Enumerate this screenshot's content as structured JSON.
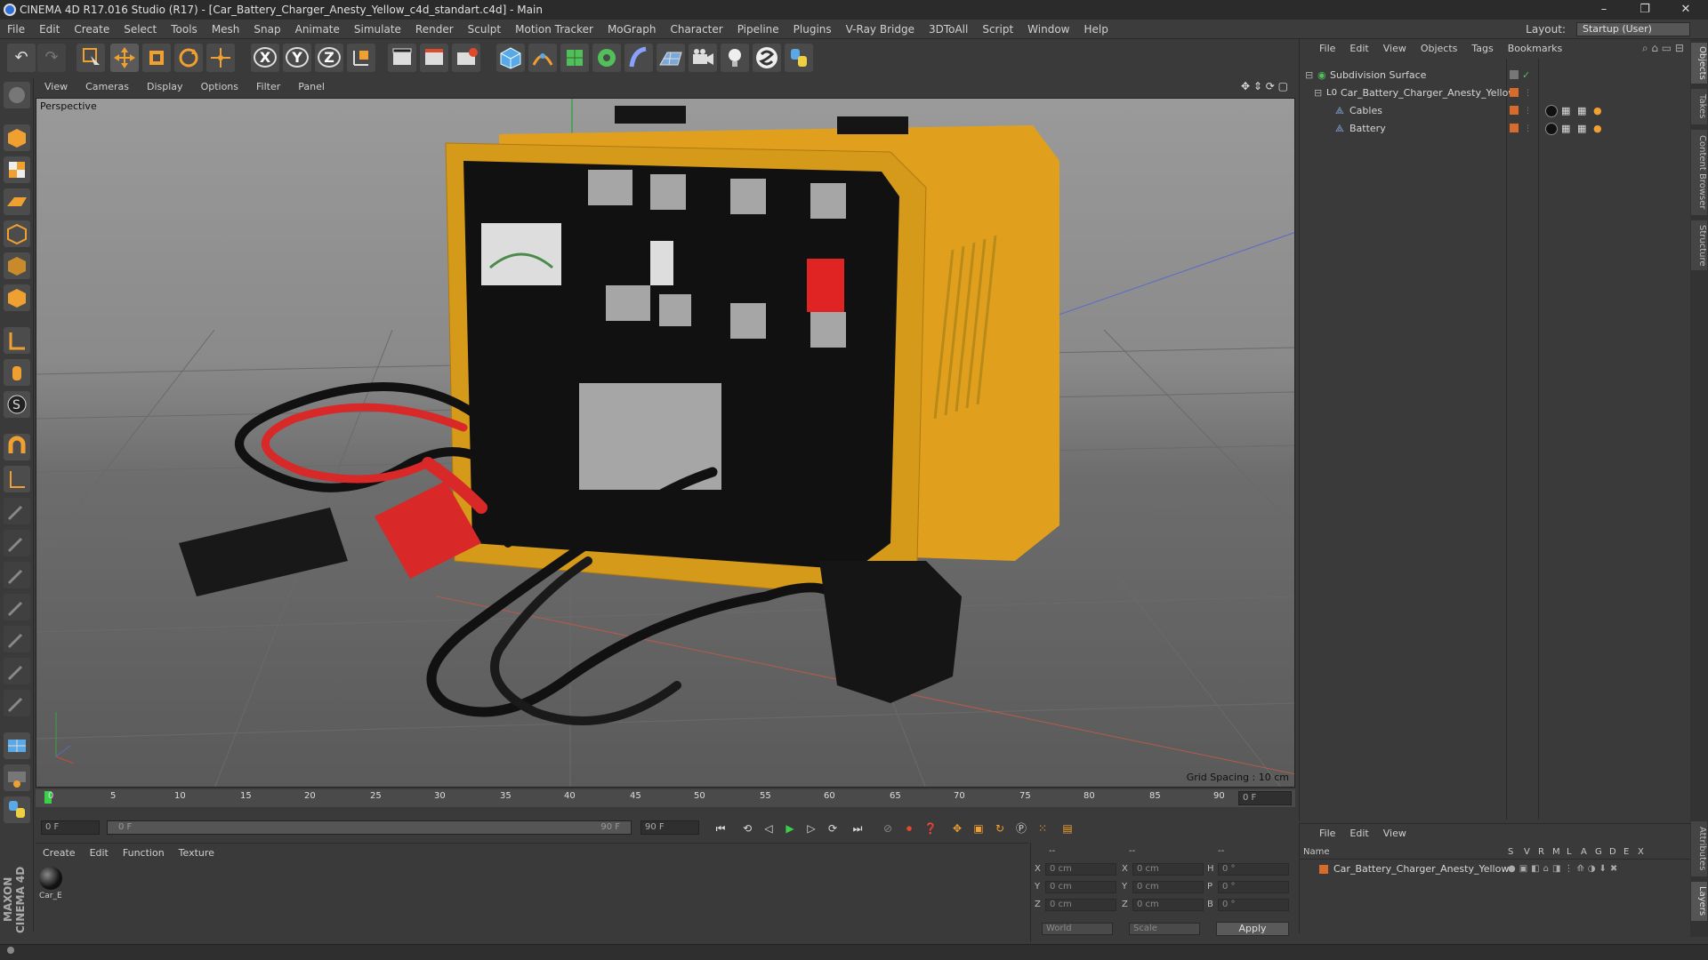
{
  "window": {
    "title": "CINEMA 4D R17.016 Studio (R17) - [Car_Battery_Charger_Anesty_Yellow_c4d_standart.c4d] - Main",
    "controls": [
      "–",
      "❐",
      "✕"
    ]
  },
  "menubar": {
    "items": [
      "File",
      "Edit",
      "Create",
      "Select",
      "Tools",
      "Mesh",
      "Snap",
      "Animate",
      "Simulate",
      "Render",
      "Sculpt",
      "Motion Tracker",
      "MoGraph",
      "Character",
      "Pipeline",
      "Plugins",
      "V-Ray Bridge",
      "3DToAll",
      "Script",
      "Window",
      "Help"
    ],
    "layout_label": "Layout:",
    "layout_value": "Startup (User)"
  },
  "toolbar": {
    "axis_x": "X",
    "axis_y": "Y",
    "axis_z": "Z",
    "colors": {
      "orange": "#f0a030",
      "blue": "#5aa8e8",
      "green": "#52c05a"
    }
  },
  "viewport": {
    "menu": [
      "View",
      "Cameras",
      "Display",
      "Options",
      "Filter",
      "Panel"
    ],
    "label": "Perspective",
    "grid_spacing": "Grid Spacing : 10 cm"
  },
  "timeline": {
    "ticks": [
      "0",
      "5",
      "10",
      "15",
      "20",
      "25",
      "30",
      "35",
      "40",
      "45",
      "50",
      "55",
      "60",
      "65",
      "70",
      "75",
      "80",
      "85",
      "90"
    ],
    "current_frame": "0 F",
    "end_frame_display": "0 F"
  },
  "transport": {
    "start_field": "0 F",
    "range_start": "0 F",
    "range_end": "90 F",
    "end_field": "90 F"
  },
  "material_panel": {
    "menu": [
      "Create",
      "Edit",
      "Function",
      "Texture"
    ],
    "material_name": "Car_E"
  },
  "coord_panel": {
    "rows": [
      {
        "l1": "X",
        "v1": "0 cm",
        "l2": "X",
        "v2": "0 cm",
        "l3": "H",
        "v3": "0 °"
      },
      {
        "l1": "Y",
        "v1": "0 cm",
        "l2": "Y",
        "v2": "0 cm",
        "l3": "P",
        "v3": "0 °"
      },
      {
        "l1": "Z",
        "v1": "0 cm",
        "l2": "Z",
        "v2": "0 cm",
        "l3": "B",
        "v3": "0 °"
      }
    ],
    "header": "--",
    "world": "World",
    "scale": "Scale",
    "apply": "Apply"
  },
  "object_manager": {
    "menu": [
      "File",
      "Edit",
      "View",
      "Objects",
      "Tags",
      "Bookmarks"
    ],
    "objects": [
      {
        "name": "Subdivision Surface",
        "indent": 0
      },
      {
        "name": "Car_Battery_Charger_Anesty_Yellow",
        "indent": 1
      },
      {
        "name": "Cables",
        "indent": 2
      },
      {
        "name": "Battery",
        "indent": 2
      }
    ]
  },
  "layer_manager": {
    "menu": [
      "File",
      "Edit",
      "View"
    ],
    "header_name": "Name",
    "header_cols": [
      "S",
      "V",
      "R",
      "M",
      "L",
      "A",
      "G",
      "D",
      "E",
      "X"
    ],
    "layer_name": "Car_Battery_Charger_Anesty_Yellow"
  },
  "right_tabs": [
    "Objects",
    "Takes",
    "Content Browser",
    "Structure",
    "Attributes",
    "Layers"
  ],
  "logo": "MAXON CINEMA 4D"
}
